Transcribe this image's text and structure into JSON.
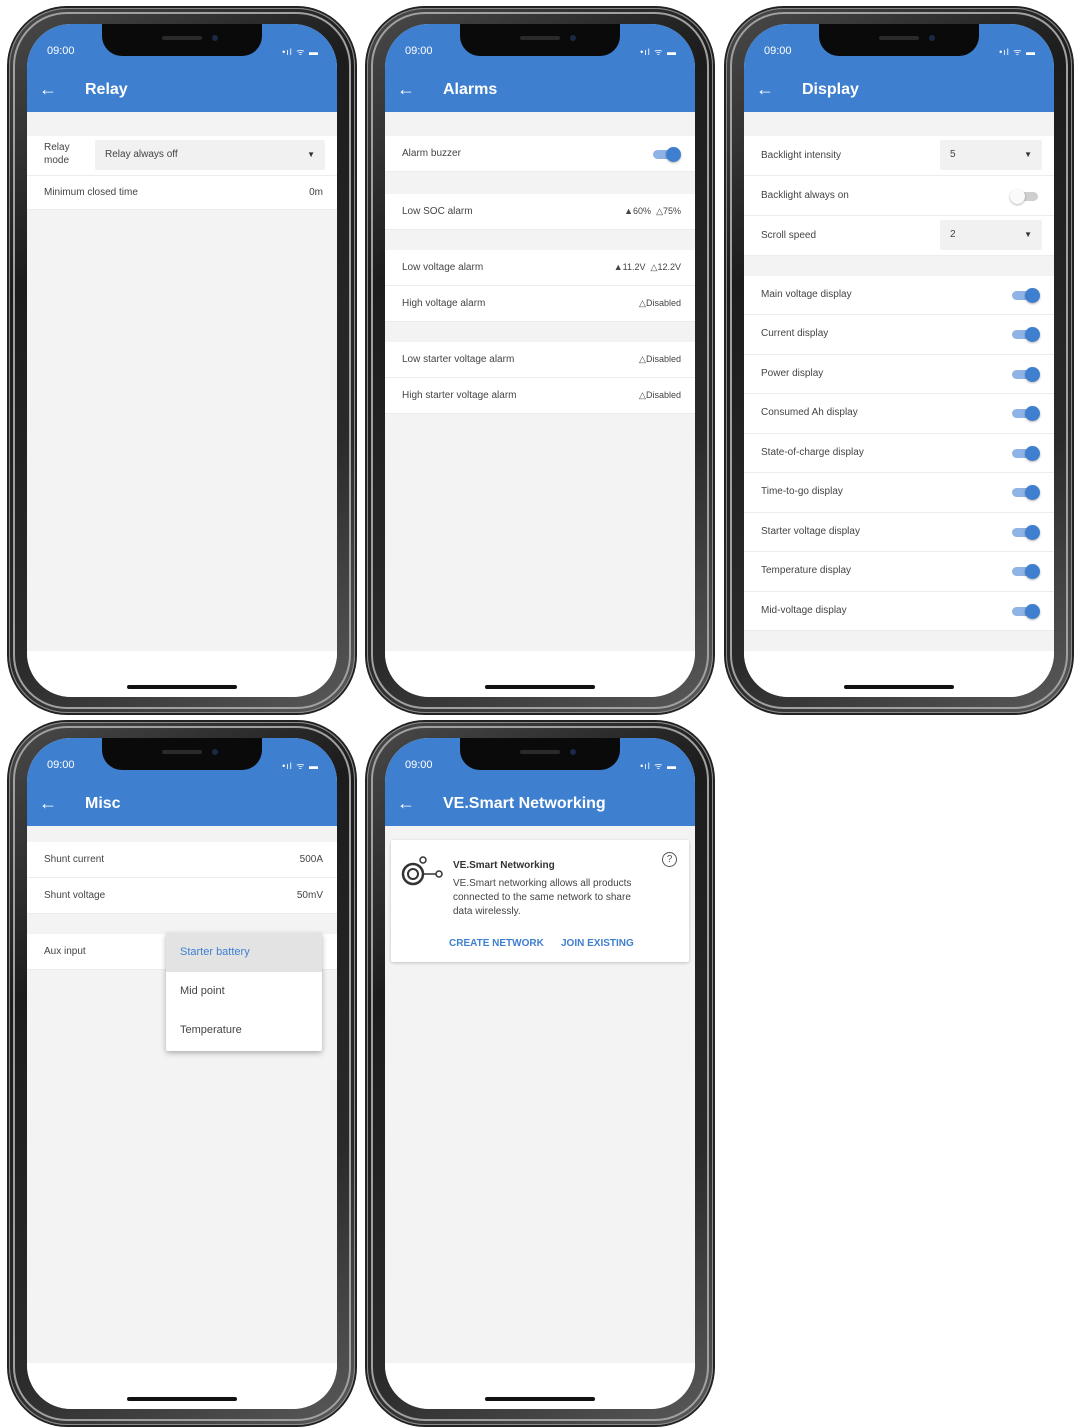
{
  "status": {
    "time": "09:00",
    "icons": "•ıl ᯤ ▬"
  },
  "relay": {
    "title": "Relay",
    "mode_label_1": "Relay",
    "mode_label_2": "mode",
    "mode_value": "Relay always off",
    "min_closed_label": "Minimum closed time",
    "min_closed_value": "0m"
  },
  "alarms": {
    "title": "Alarms",
    "buzzer_label": "Alarm buzzer",
    "buzzer_on": true,
    "rows": [
      {
        "label": "Low SOC alarm",
        "set": "60%",
        "clear": "75%"
      },
      {
        "label": "Low voltage alarm",
        "set": "11.2V",
        "clear": "12.2V"
      },
      {
        "label": "High voltage alarm",
        "value": "Disabled"
      },
      {
        "label": "Low starter voltage alarm",
        "value": "Disabled"
      },
      {
        "label": "High starter voltage alarm",
        "value": "Disabled"
      }
    ]
  },
  "display": {
    "title": "Display",
    "backlight_intensity_label": "Backlight intensity",
    "backlight_intensity_value": "5",
    "backlight_always_on_label": "Backlight always on",
    "backlight_always_on": false,
    "scroll_speed_label": "Scroll speed",
    "scroll_speed_value": "2",
    "toggles": [
      {
        "label": "Main voltage display",
        "on": true
      },
      {
        "label": "Current display",
        "on": true
      },
      {
        "label": "Power display",
        "on": true
      },
      {
        "label": "Consumed Ah display",
        "on": true
      },
      {
        "label": "State-of-charge display",
        "on": true
      },
      {
        "label": "Time-to-go display",
        "on": true
      },
      {
        "label": "Starter voltage display",
        "on": true
      },
      {
        "label": "Temperature display",
        "on": true
      },
      {
        "label": "Mid-voltage display",
        "on": true
      }
    ]
  },
  "misc": {
    "title": "Misc",
    "shunt_current_label": "Shunt current",
    "shunt_current_value": "500A",
    "shunt_voltage_label": "Shunt voltage",
    "shunt_voltage_value": "50mV",
    "aux_input_label": "Aux input",
    "aux_options": [
      "Starter battery",
      "Mid point",
      "Temperature"
    ],
    "aux_selected": "Starter battery"
  },
  "networking": {
    "title": "VE.Smart Networking",
    "card_title": "VE.Smart Networking",
    "card_text_1": "VE.Smart networking allows all products",
    "card_text_2": "connected to the same network to share",
    "card_text_3": "data wirelessly.",
    "create_label": "CREATE NETWORK",
    "join_label": "JOIN EXISTING"
  }
}
